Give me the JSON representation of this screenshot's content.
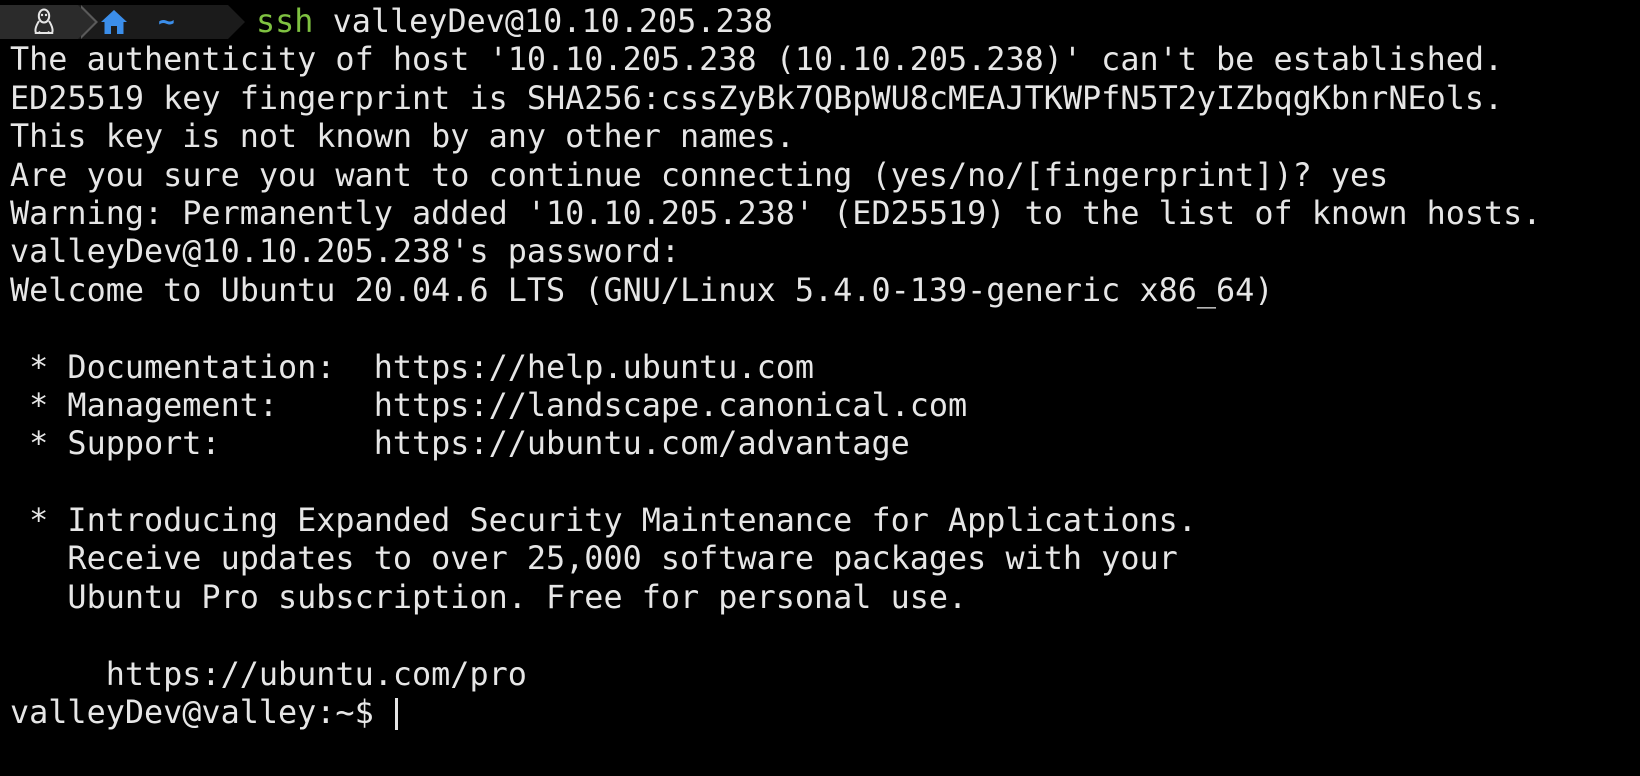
{
  "prompt": {
    "os_icon": "linux-tux-icon",
    "home_icon": "home-icon",
    "cwd": "~",
    "command": "ssh",
    "argument": "valleyDev@10.10.205.238"
  },
  "output": [
    "The authenticity of host '10.10.205.238 (10.10.205.238)' can't be established.",
    "ED25519 key fingerprint is SHA256:cssZyBk7QBpWU8cMEAJTKWPfN5T2yIZbqgKbnrNEols.",
    "This key is not known by any other names.",
    "Are you sure you want to continue connecting (yes/no/[fingerprint])? yes",
    "Warning: Permanently added '10.10.205.238' (ED25519) to the list of known hosts.",
    "valleyDev@10.10.205.238's password:",
    "Welcome to Ubuntu 20.04.6 LTS (GNU/Linux 5.4.0-139-generic x86_64)",
    "",
    " * Documentation:  https://help.ubuntu.com",
    " * Management:     https://landscape.canonical.com",
    " * Support:        https://ubuntu.com/advantage",
    "",
    " * Introducing Expanded Security Maintenance for Applications.",
    "   Receive updates to over 25,000 software packages with your",
    "   Ubuntu Pro subscription. Free for personal use.",
    "",
    "     https://ubuntu.com/pro"
  ],
  "shell_prompt": "valleyDev@valley:~$ ",
  "colors": {
    "background": "#000000",
    "foreground": "#e6e6e6",
    "command": "#7fc241",
    "tilde": "#3b8eea",
    "home_icon": "#3b8eea"
  }
}
